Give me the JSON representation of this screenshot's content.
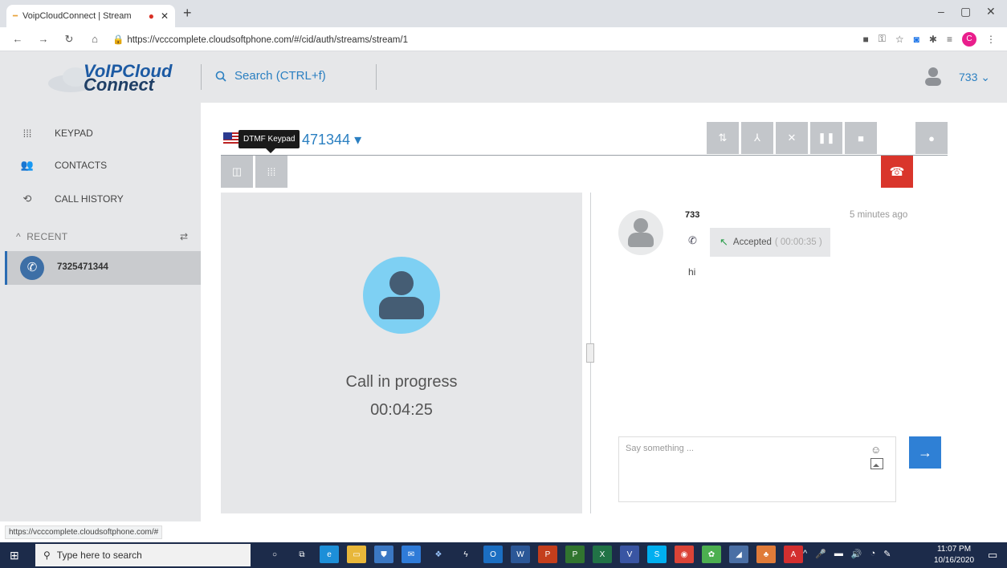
{
  "browser": {
    "tab_title": "VoipCloudConnect | Stream",
    "url": "https://vcccomplete.cloudsoftphone.com/#/cid/auth/streams/stream/1",
    "profile_initial": "C"
  },
  "header": {
    "logo_line1": "VoIPCloud",
    "logo_line2": "Connect",
    "search_label": "Search (CTRL+f)",
    "user_label": "733"
  },
  "sidebar": {
    "items": [
      {
        "label": "KEYPAD",
        "icon": "keypad-icon"
      },
      {
        "label": "CONTACTS",
        "icon": "contacts-icon"
      },
      {
        "label": "CALL HISTORY",
        "icon": "history-icon"
      }
    ],
    "recent_label": "RECENT",
    "recent_items": [
      {
        "number": "7325471344"
      }
    ]
  },
  "call": {
    "tooltip": "DTMF Keypad",
    "phone_number": "471344",
    "status": "Call in progress",
    "timer": "00:04:25"
  },
  "chat": {
    "sender": "733",
    "time": "5 minutes ago",
    "event_label": "Accepted",
    "event_duration": "( 00:00:35 )",
    "message": "hi",
    "input_placeholder": "Say something ..."
  },
  "statusbar": {
    "url": "https://vcccomplete.cloudsoftphone.com/#"
  },
  "taskbar": {
    "search_placeholder": "Type here to search",
    "time": "11:07 PM",
    "date": "10/16/2020"
  },
  "colors": {
    "accent": "#2a7fc1",
    "hangup": "#d9352b",
    "send": "#2f80d5"
  }
}
